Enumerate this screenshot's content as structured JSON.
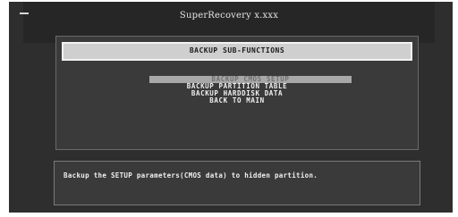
{
  "window": {
    "title": "SuperRecovery x.xxx"
  },
  "submenu": {
    "header": "BACKUP SUB-FUNCTIONS",
    "items": [
      {
        "label": "BACKUP CMOS SETUP",
        "selected": true
      },
      {
        "label": "BACKUP PARTITION TABLE",
        "selected": false
      },
      {
        "label": "BACKUP HARDDISK DATA",
        "selected": false
      },
      {
        "label": "BACK TO MAIN",
        "selected": false
      }
    ]
  },
  "description": {
    "text": "Backup the SETUP parameters(CMOS data) to hidden partition."
  },
  "colors": {
    "background": "#2e2e2e",
    "highlight": "#a8a8a8",
    "text": "#f0f0f0"
  }
}
